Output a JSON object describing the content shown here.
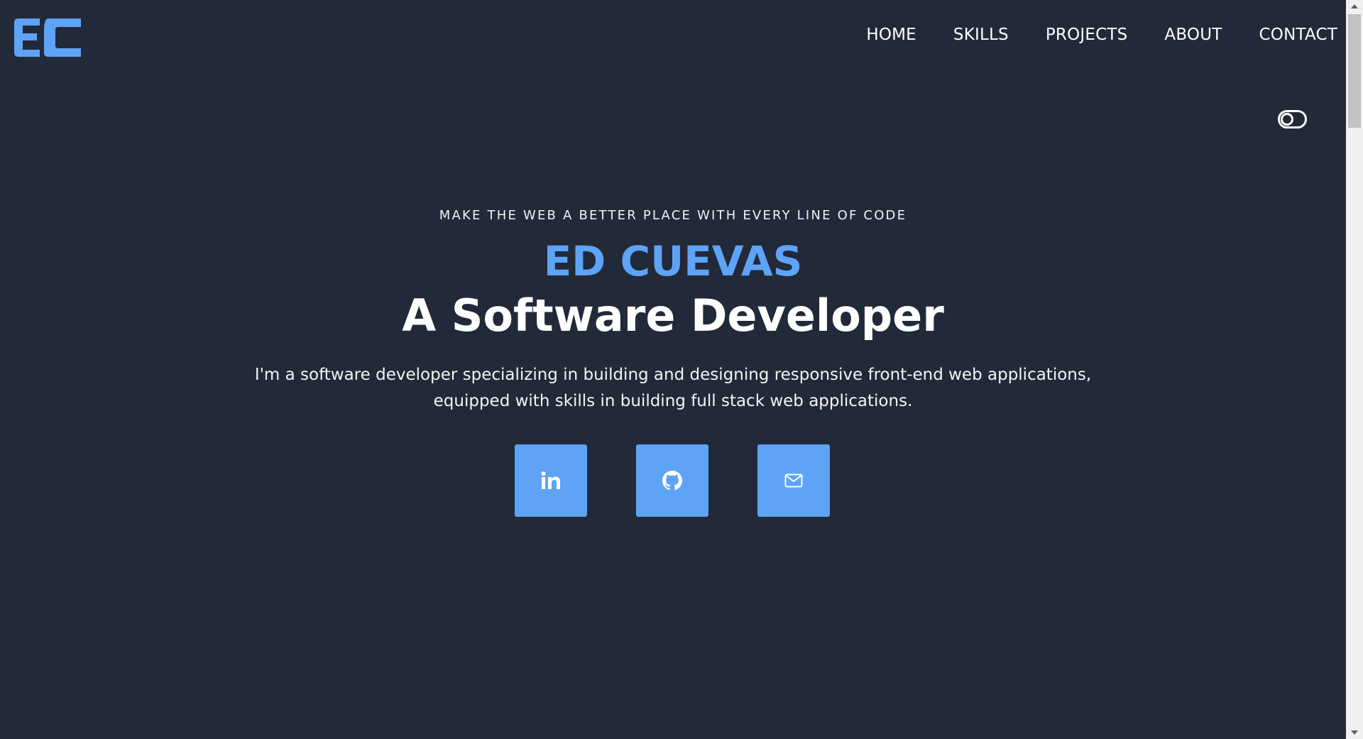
{
  "header": {
    "logo_text": "EC",
    "nav": [
      {
        "label": "HOME"
      },
      {
        "label": "SKILLS"
      },
      {
        "label": "PROJECTS"
      },
      {
        "label": "ABOUT"
      },
      {
        "label": "CONTACT"
      }
    ]
  },
  "hero": {
    "tagline": "MAKE THE WEB A BETTER PLACE WITH EVERY LINE OF CODE",
    "name": "ED CUEVAS",
    "role": "A Software Developer",
    "description": "I'm a software developer specializing in building and designing responsive front-end web applications, equipped with skills in building full stack web applications."
  },
  "socials": [
    {
      "icon": "linkedin-icon"
    },
    {
      "icon": "github-icon"
    },
    {
      "icon": "mail-icon"
    }
  ],
  "colors": {
    "background": "#222938",
    "accent": "#5ea3f6",
    "text": "#ffffff"
  }
}
